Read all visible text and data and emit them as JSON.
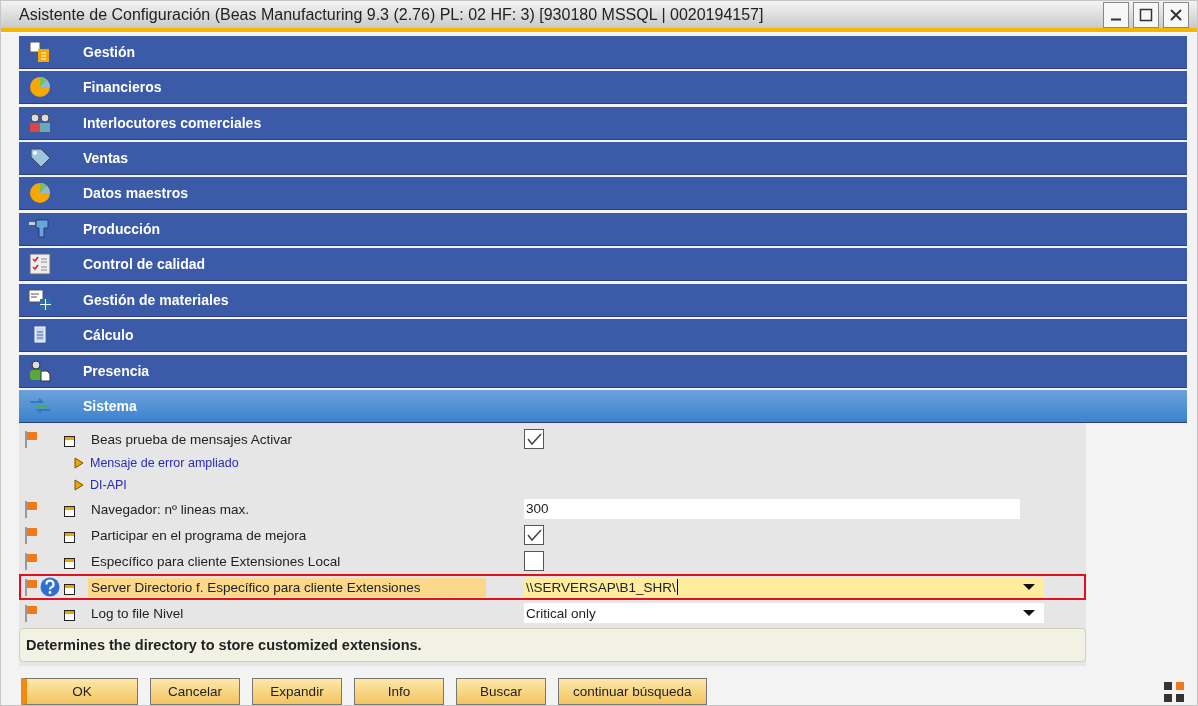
{
  "window": {
    "title": "Asistente de Configuración (Beas Manufacturing 9.3 (2.76) PL: 02 HF: 3) [930180 MSSQL | 0020194157]"
  },
  "sections": [
    {
      "label": "Gestión",
      "selected": false
    },
    {
      "label": "Financieros",
      "selected": false
    },
    {
      "label": "Interlocutores comerciales",
      "selected": false
    },
    {
      "label": "Ventas",
      "selected": false
    },
    {
      "label": "Datos maestros",
      "selected": false
    },
    {
      "label": "Producción",
      "selected": false
    },
    {
      "label": "Control de calidad",
      "selected": false
    },
    {
      "label": "Gestión de materiales",
      "selected": false
    },
    {
      "label": "Cálculo",
      "selected": false
    },
    {
      "label": "Presencia",
      "selected": false
    },
    {
      "label": "Sistema",
      "selected": true
    }
  ],
  "settings": [
    {
      "kind": "checkbox",
      "label": "Beas prueba de mensajes Activar",
      "checked": true,
      "selected": false
    },
    {
      "kind": "group",
      "label": "Mensaje de error ampliado"
    },
    {
      "kind": "group",
      "label": "DI-API"
    },
    {
      "kind": "text",
      "label": "Navegador: nº lineas max.",
      "value": "300",
      "selected": false
    },
    {
      "kind": "checkbox",
      "label": "Participar en el programa de mejora",
      "checked": true,
      "selected": false
    },
    {
      "kind": "checkbox",
      "label": "Específico para cliente Extensiones Local",
      "checked": false,
      "selected": false
    },
    {
      "kind": "combo",
      "label": "Server Directorio f. Específico para cliente Extensiones",
      "value": "\\\\SERVERSAP\\B1_SHR\\",
      "selected": true
    },
    {
      "kind": "combo",
      "label": "Log to file Nivel",
      "value": "Critical only",
      "selected": false
    }
  ],
  "help": "Determines the directory to store customized extensions.",
  "buttons": [
    {
      "label": "OK",
      "default": true
    },
    {
      "label": "Cancelar",
      "default": false
    },
    {
      "label": "Expandir",
      "default": false
    },
    {
      "label": "Info",
      "default": false
    },
    {
      "label": "Buscar",
      "default": false
    },
    {
      "label": "continuar búsqueda",
      "default": false
    }
  ]
}
